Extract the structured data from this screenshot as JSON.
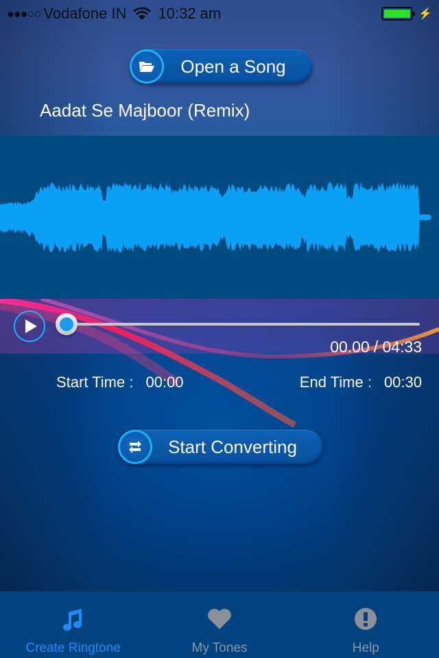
{
  "status_bar": {
    "signal": "●●●○○",
    "carrier": "Vodafone IN",
    "time": "10:32 am",
    "battery_level": 1.0,
    "charging": true
  },
  "colors": {
    "accent": "#1ab1f5",
    "waveform": "#0aa0f5",
    "waveform_bg": "#004a80",
    "tab_active": "#1e8cf2",
    "tab_inactive": "#8a97a8",
    "battery": "#2be022"
  },
  "open_button": {
    "label": "Open a Song",
    "icon": "folder-open-icon"
  },
  "song": {
    "title": "Aadat Se Majboor (Remix)"
  },
  "player": {
    "play_icon": "play-icon",
    "progress": 0.0,
    "current_time": "00.00",
    "separator": "/",
    "duration": "04:33"
  },
  "trim": {
    "start_label": "Start Time :",
    "start_value": "00:00",
    "end_label": "End Time :",
    "end_value": "00:30"
  },
  "convert_button": {
    "label": "Start Converting",
    "icon": "repeat-icon"
  },
  "tabs": [
    {
      "label": "Create Ringtone",
      "icon": "music-note-icon",
      "active": true
    },
    {
      "label": "My Tones",
      "icon": "heart-icon",
      "active": false
    },
    {
      "label": "Help",
      "icon": "exclamation-icon",
      "active": false
    }
  ]
}
